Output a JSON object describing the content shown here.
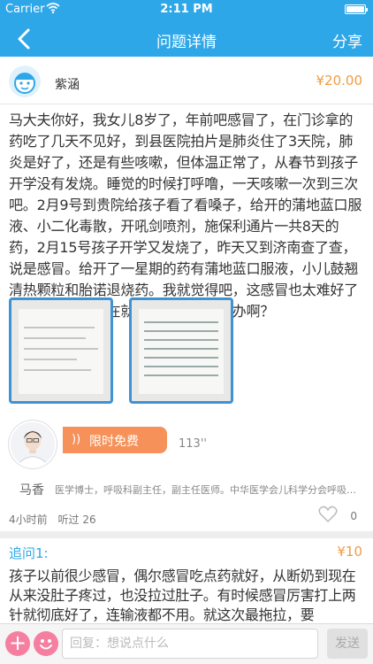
{
  "status_bar": {
    "carrier": "Carrier",
    "time": "2:11 PM"
  },
  "nav": {
    "title": "问题详情",
    "share": "分享"
  },
  "asker": {
    "name": "紫涵",
    "price": "¥20.00"
  },
  "question": {
    "text": "马大夫你好，我女儿8岁了，年前吧感冒了，在门诊拿的药吃了几天不见好，到县医院拍片是肺炎住了3天院，肺炎是好了，还是有些咳嗽，但体温正常了，从春节到孩子开学没有发烧。睡觉的时候打呼噜，一天咳嗽一次到三次吧。2月9号到贵院给孩子看了看嗓子，给开的蒲地蓝口服液、小二化毒散，开吼剑喷剂，施保利通片一共8天的药，2月15号孩子开学又发烧了，昨天又到济南查了查，说是感冒。给开了一星期的药有蒲地蓝口服液，小儿鼓翘清热颗粒和胎诺退烧药。我就觉得吧，这感冒也太难好了吧！从年前到现在就没好利索。怎么办啊？"
  },
  "answer": {
    "voice_label": "限时免费",
    "duration": "113''",
    "doctor_name": "马香",
    "doctor_title": "医学博士，呼吸科副主任，副主任医师。中华医学会儿科学分会呼吸学组委员",
    "time_ago": "4小时前",
    "listened_label": "听过",
    "listened_count": "26",
    "likes": "0"
  },
  "followup": {
    "title": "追问1:",
    "price": "¥10",
    "text": "孩子以前很少感冒，偶尔感冒吃点药就好，从断奶到现在从来没肚子疼过，也没拉过肚子。有时候感冒厉害打上两针就彻底好了，连输液都不用。就这次最拖拉，要"
  },
  "reply": {
    "placeholder": "回复：想说点什么",
    "send": "发送"
  },
  "colors": {
    "nav": "#2ea7e8",
    "price": "#f29b42",
    "voice": "#f59159",
    "accent_pink": "#f47fa1"
  }
}
